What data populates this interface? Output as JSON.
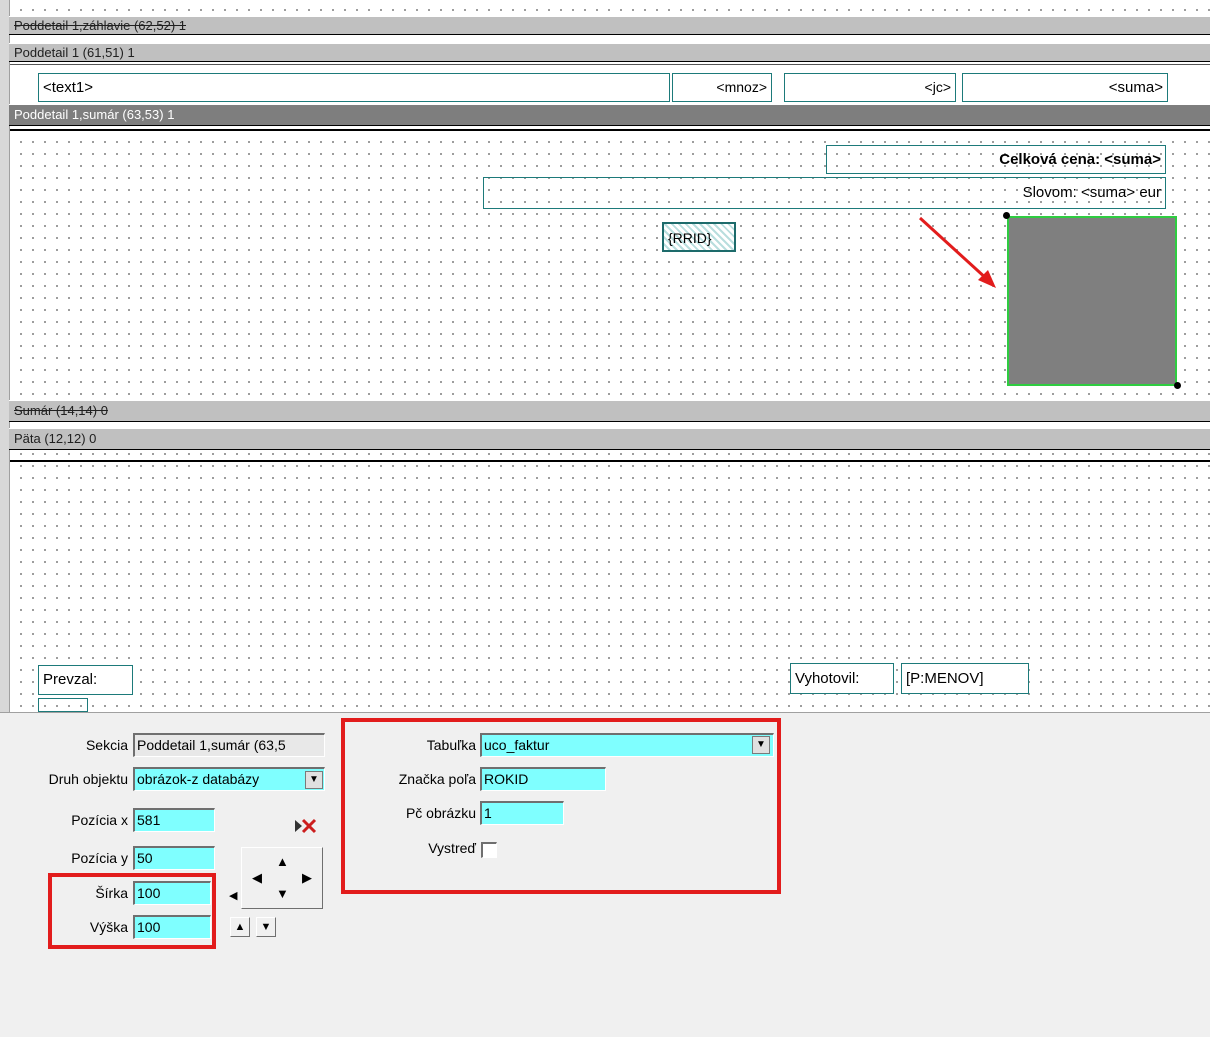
{
  "bands": {
    "header": "Poddetail 1,záhlavie (62,52) 1",
    "detail": "Poddetail 1 (61,51) 1",
    "summary": "Poddetail 1,sumár (63,53) 1",
    "sum": "Sumár (14,14) 0",
    "footer": "Päta (12,12) 0"
  },
  "detail_fields": {
    "text1": "<text1>",
    "mnoz": "<mnoz>",
    "jc": "<jc>",
    "suma": "<suma>"
  },
  "summary_fields": {
    "celkova": "Celková cena: <suma>",
    "slovom": "Slovom: <suma> eur",
    "rrid": "{RRID}"
  },
  "footer_fields": {
    "prevzal": "Prevzal:",
    "vyhotovil": "Vyhotovil:",
    "menov": "[P:MENOV]"
  },
  "props": {
    "sekcia_label": "Sekcia",
    "sekcia_value": "Poddetail 1,sumár (63,5",
    "druh_label": "Druh objektu",
    "druh_value": "obrázok-z databázy",
    "pozx_label": "Pozícia x",
    "pozx_value": "581",
    "pozy_label": "Pozícia y",
    "pozy_value": "50",
    "sirka_label": "Šírka",
    "sirka_value": "100",
    "vyska_label": "Výška",
    "vyska_value": "100",
    "tabulka_label": "Tabuľka",
    "tabulka_value": "uco_faktur",
    "znacka_label": "Značka poľa",
    "znacka_value": "ROKID",
    "pc_label": "Pč obrázku",
    "pc_value": "1",
    "vystred_label": "Vystreď"
  },
  "colors": {
    "accent_red": "#e21c1c",
    "input_cyan": "#7fffff",
    "image_gray": "#7f7f7f",
    "selection_green": "#2ecc40",
    "field_teal": "#1d7a7a"
  }
}
